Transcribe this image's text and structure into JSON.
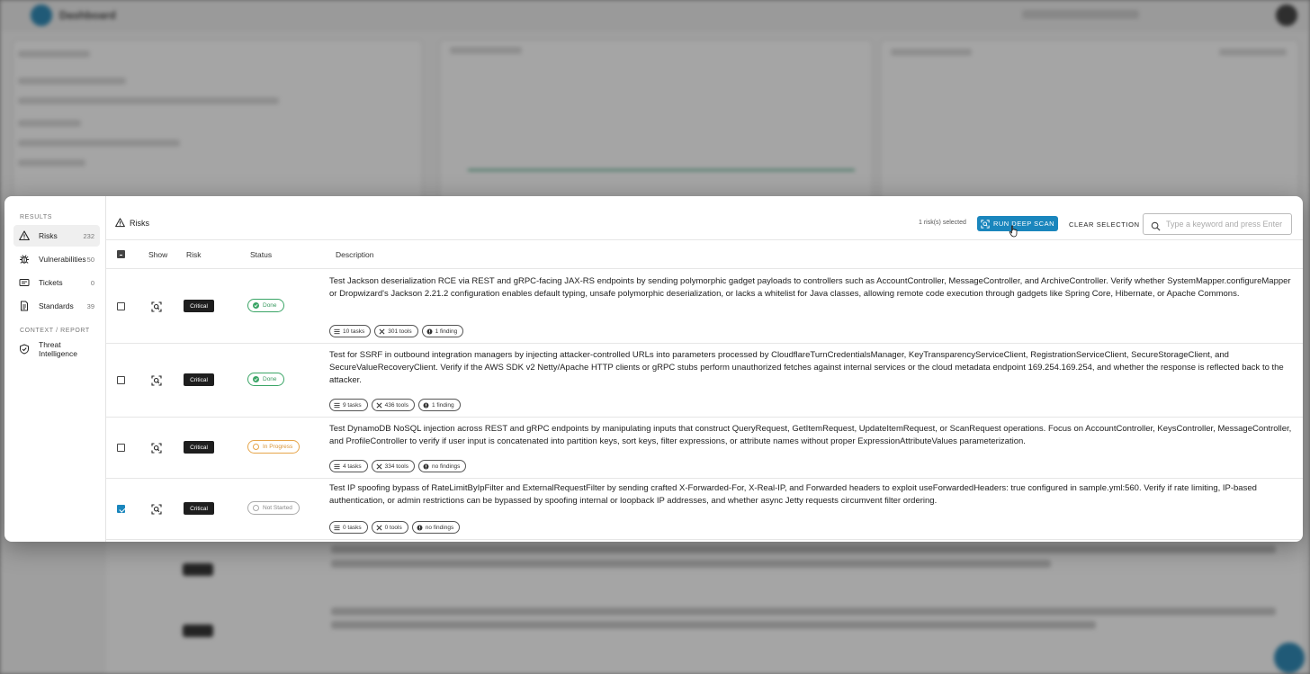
{
  "background": {
    "brand": "Dashboard"
  },
  "sidebar": {
    "section_results": "RESULTS",
    "section_context": "CONTEXT / REPORT",
    "items": [
      {
        "label": "Risks",
        "count": "232",
        "icon": "warning-icon",
        "active": true
      },
      {
        "label": "Vulnerabilities",
        "count": "50",
        "icon": "bug-icon"
      },
      {
        "label": "Tickets",
        "count": "0",
        "icon": "ticket-icon"
      },
      {
        "label": "Standards",
        "count": "39",
        "icon": "document-icon"
      }
    ],
    "context_items": [
      {
        "label": "Threat Intelligence",
        "icon": "shield-icon"
      }
    ]
  },
  "header": {
    "title": "Risks",
    "selected_text": "1 risk(s) selected",
    "deep_scan_label": "RUN DEEP SCAN",
    "clear_label": "CLEAR SELECTION",
    "search_placeholder": "Type a keyword and press Enter"
  },
  "table": {
    "columns": [
      "Show",
      "Risk",
      "Status",
      "Description"
    ],
    "rows": [
      {
        "checked": false,
        "risk": "Critical",
        "status": "Done",
        "description": "Test Jackson deserialization RCE via REST and gRPC-facing JAX-RS endpoints by sending polymorphic gadget payloads to controllers such as AccountController, MessageController, and ArchiveController. Verify whether SystemMapper.configureMapper or Dropwizard's Jackson 2.21.2 configuration enables default typing, unsafe polymorphic deserialization, or lacks a whitelist for Java classes, allowing remote code execution through gadgets like Spring Core, Hibernate, or Apache Commons.",
        "tasks": "10 tasks",
        "tools": "301 tools",
        "findings": "1 finding"
      },
      {
        "checked": false,
        "risk": "Critical",
        "status": "Done",
        "description": "Test for SSRF in outbound integration managers by injecting attacker-controlled URLs into parameters processed by CloudflareTurnCredentialsManager, KeyTransparencyServiceClient, RegistrationServiceClient, SecureStorageClient, and SecureValueRecoveryClient. Verify if the AWS SDK v2 Netty/Apache HTTP clients or gRPC stubs perform unauthorized fetches against internal services or the cloud metadata endpoint 169.254.169.254, and whether the response is reflected back to the attacker.",
        "tasks": "9 tasks",
        "tools": "436 tools",
        "findings": "1 finding"
      },
      {
        "checked": false,
        "risk": "Critical",
        "status": "In Progress",
        "description": "Test DynamoDB NoSQL injection across REST and gRPC endpoints by manipulating inputs that construct QueryRequest, GetItemRequest, UpdateItemRequest, or ScanRequest operations. Focus on AccountController, KeysController, MessageController, and ProfileController to verify if user input is concatenated into partition keys, sort keys, filter expressions, or attribute names without proper ExpressionAttributeValues parameterization.",
        "tasks": "4 tasks",
        "tools": "334 tools",
        "findings": "no findings"
      },
      {
        "checked": true,
        "risk": "Critical",
        "status": "Not Started",
        "description": "Test IP spoofing bypass of RateLimitByIpFilter and ExternalRequestFilter by sending crafted X-Forwarded-For, X-Real-IP, and Forwarded headers to exploit useForwardedHeaders: true configured in sample.yml:560. Verify if rate limiting, IP-based authentication, or admin restrictions can be bypassed by spoofing internal or loopback IP addresses, and whether async Jetty requests circumvent filter ordering.",
        "tasks": "0 tasks",
        "tools": "0 tools",
        "findings": "no findings"
      }
    ]
  },
  "colors": {
    "accent": "#1a86bd",
    "critical": "#1e1e1e",
    "done": "#3aa566",
    "in_progress": "#e6a54a",
    "not_started": "#aaaaaa"
  }
}
